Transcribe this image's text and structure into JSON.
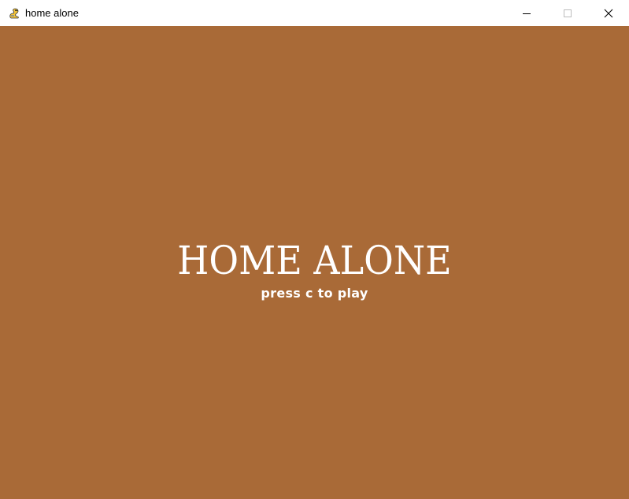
{
  "window": {
    "title": "home alone",
    "app_icon": "pygame-snake-icon",
    "controls": {
      "minimize_icon": "minimize-icon",
      "maximize_icon": "maximize-icon",
      "close_icon": "close-icon"
    }
  },
  "game": {
    "background_color": "#A96A37",
    "text_color": "#FFFFFF",
    "title": "HOME ALONE",
    "prompt": "press c to play"
  }
}
